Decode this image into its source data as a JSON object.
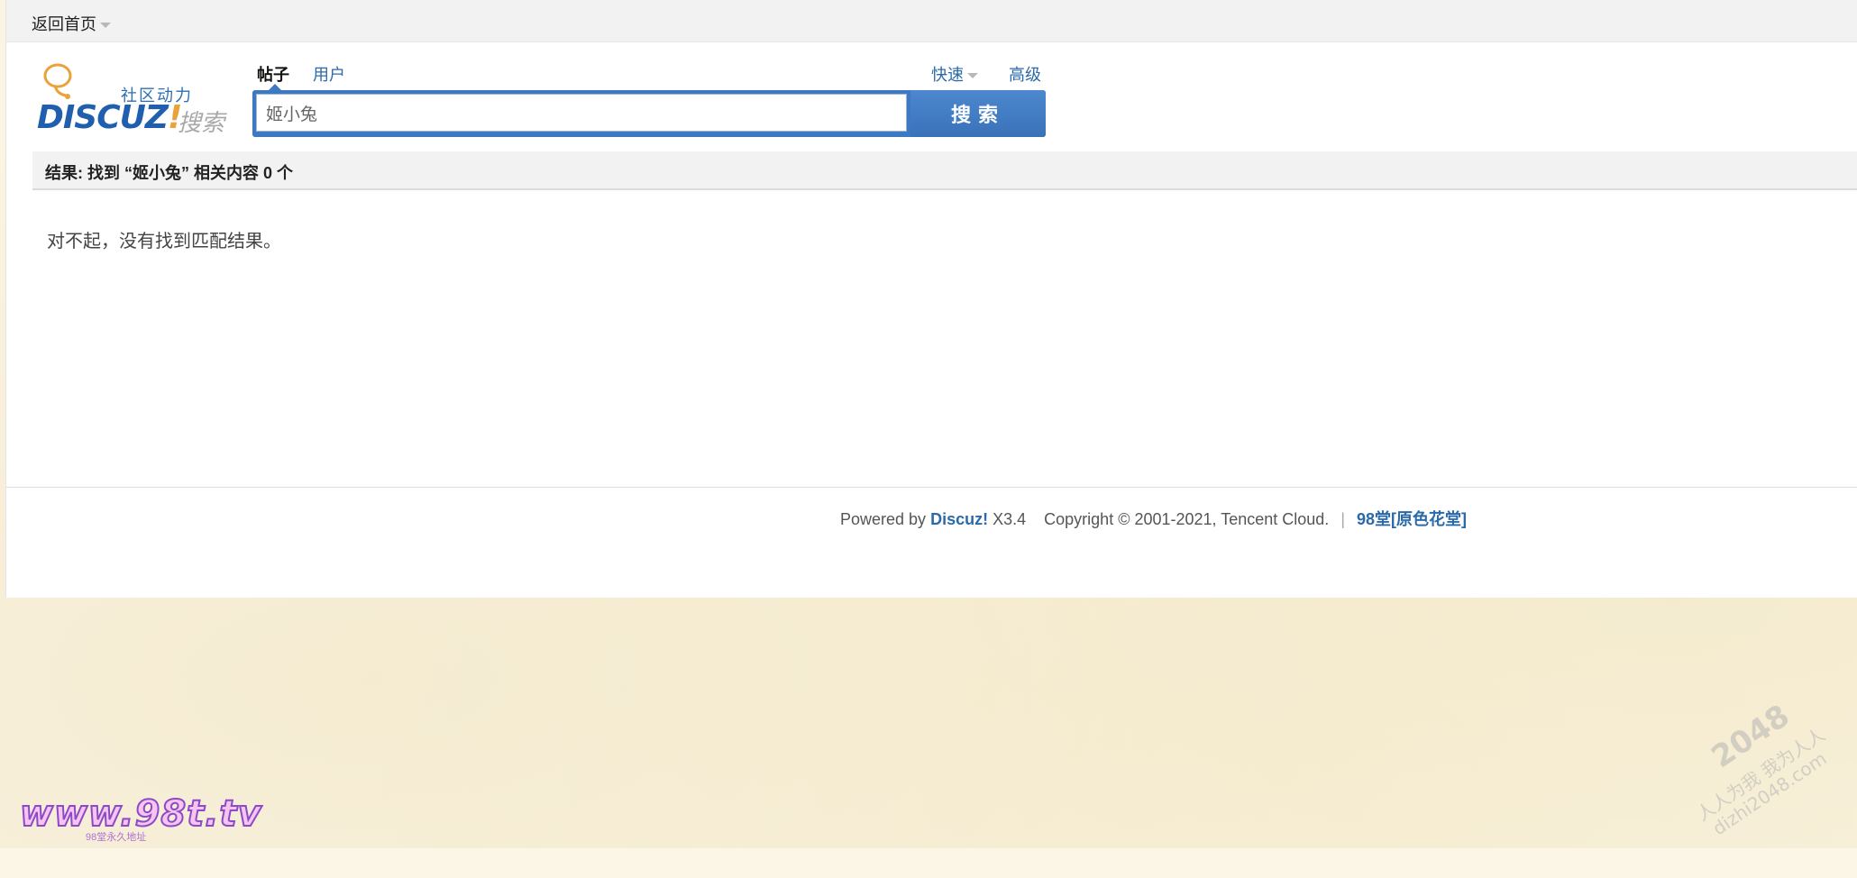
{
  "topbar": {
    "home_label": "返回首页"
  },
  "logo": {
    "community_text": "社区动力",
    "brand_text": "DISCUZ",
    "brand_bang": "!",
    "search_word": "搜索"
  },
  "tabs": [
    {
      "label": "帖子",
      "active": true
    },
    {
      "label": "用户",
      "active": false
    }
  ],
  "search": {
    "quick_label": "快速",
    "advanced_label": "高级",
    "input_value": "姬小兔",
    "button_label": "搜索"
  },
  "results": {
    "summary": "结果: 找到 “姬小兔” 相关内容 0 个",
    "empty_message": "对不起，没有找到匹配结果。"
  },
  "footer": {
    "powered_by": "Powered by",
    "discuz_link": "Discuz!",
    "version": "X3.4",
    "copyright": "Copyright © 2001-2021, Tencent Cloud.",
    "separator": "|",
    "site_link": "98堂[原色花堂]"
  },
  "watermarks": {
    "left_main": "www.98t.tv",
    "left_sub": "98堂永久地址",
    "right_big": "2048",
    "right_line1": "人人为我 我为人人",
    "right_line2": "dizhi2048.com"
  },
  "colors": {
    "accent": "#3d79c2",
    "link": "#2b6aa8",
    "topbar_bg": "#f2f2f2",
    "page_bg": "#faf4e2"
  }
}
